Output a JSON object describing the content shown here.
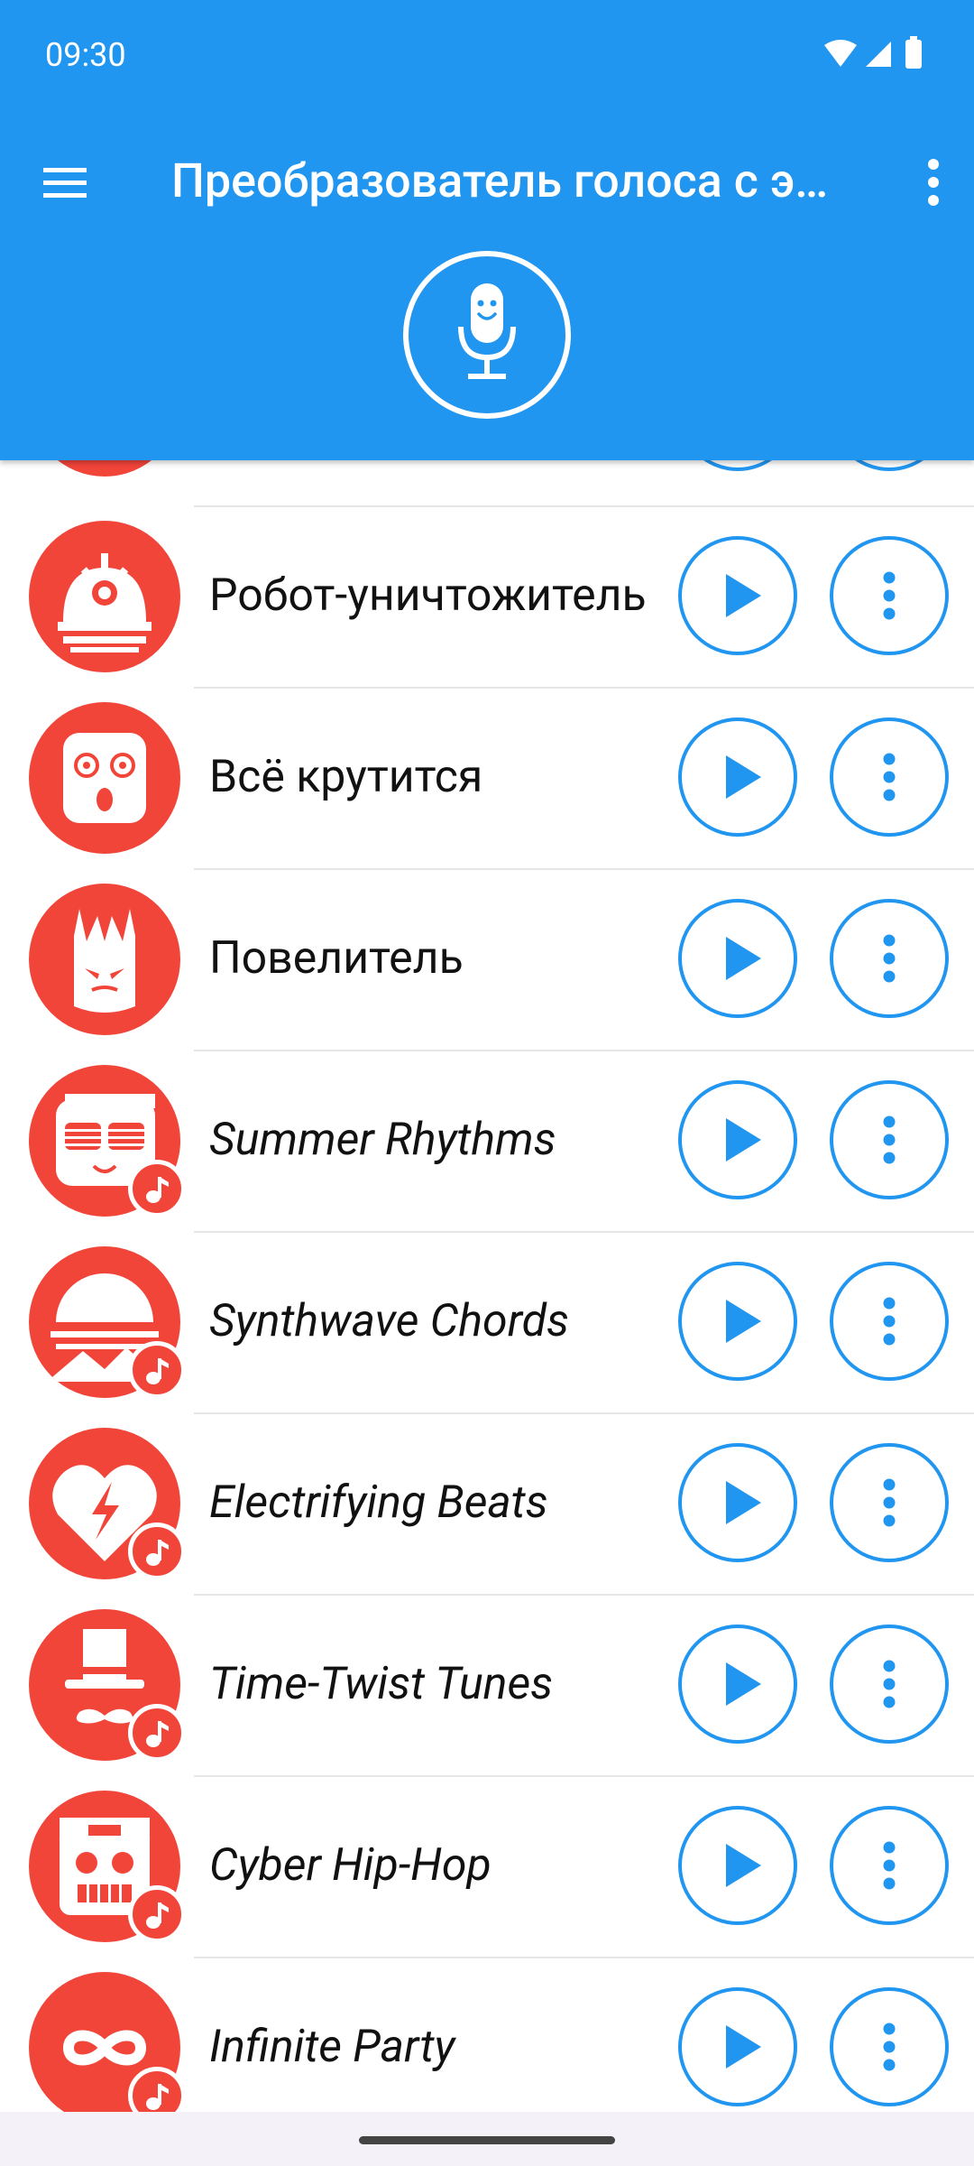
{
  "status_bar": {
    "time": "09:30"
  },
  "app_bar": {
    "title": "Преобразователь голоса с э…",
    "menu_icon": "hamburger-menu-icon",
    "overflow_icon": "more-vert-icon",
    "mic_icon": "smiling-microphone-icon"
  },
  "colors": {
    "primary": "#2196f0",
    "accent_red": "#f2453a"
  },
  "effects": [
    {
      "label": "Робот-уничтожитель",
      "italic": false,
      "music": false,
      "icon": "robot-dome-icon"
    },
    {
      "label": "Всё крутится",
      "italic": false,
      "music": false,
      "icon": "dizzy-face-icon"
    },
    {
      "label": "Повелитель",
      "italic": false,
      "music": false,
      "icon": "horned-demon-icon"
    },
    {
      "label": "Summer Rhythms",
      "italic": true,
      "music": true,
      "icon": "sunglasses-face-icon"
    },
    {
      "label": "Synthwave Chords",
      "italic": true,
      "music": true,
      "icon": "retro-sunset-icon"
    },
    {
      "label": "Electrifying Beats",
      "italic": true,
      "music": true,
      "icon": "lightning-heart-icon"
    },
    {
      "label": "Time-Twist Tunes",
      "italic": true,
      "music": true,
      "icon": "top-hat-mustache-icon"
    },
    {
      "label": "Cyber Hip-Hop",
      "italic": true,
      "music": true,
      "icon": "cyber-boombox-face-icon"
    },
    {
      "label": "Infinite Party",
      "italic": true,
      "music": true,
      "icon": "infinity-icon"
    }
  ]
}
